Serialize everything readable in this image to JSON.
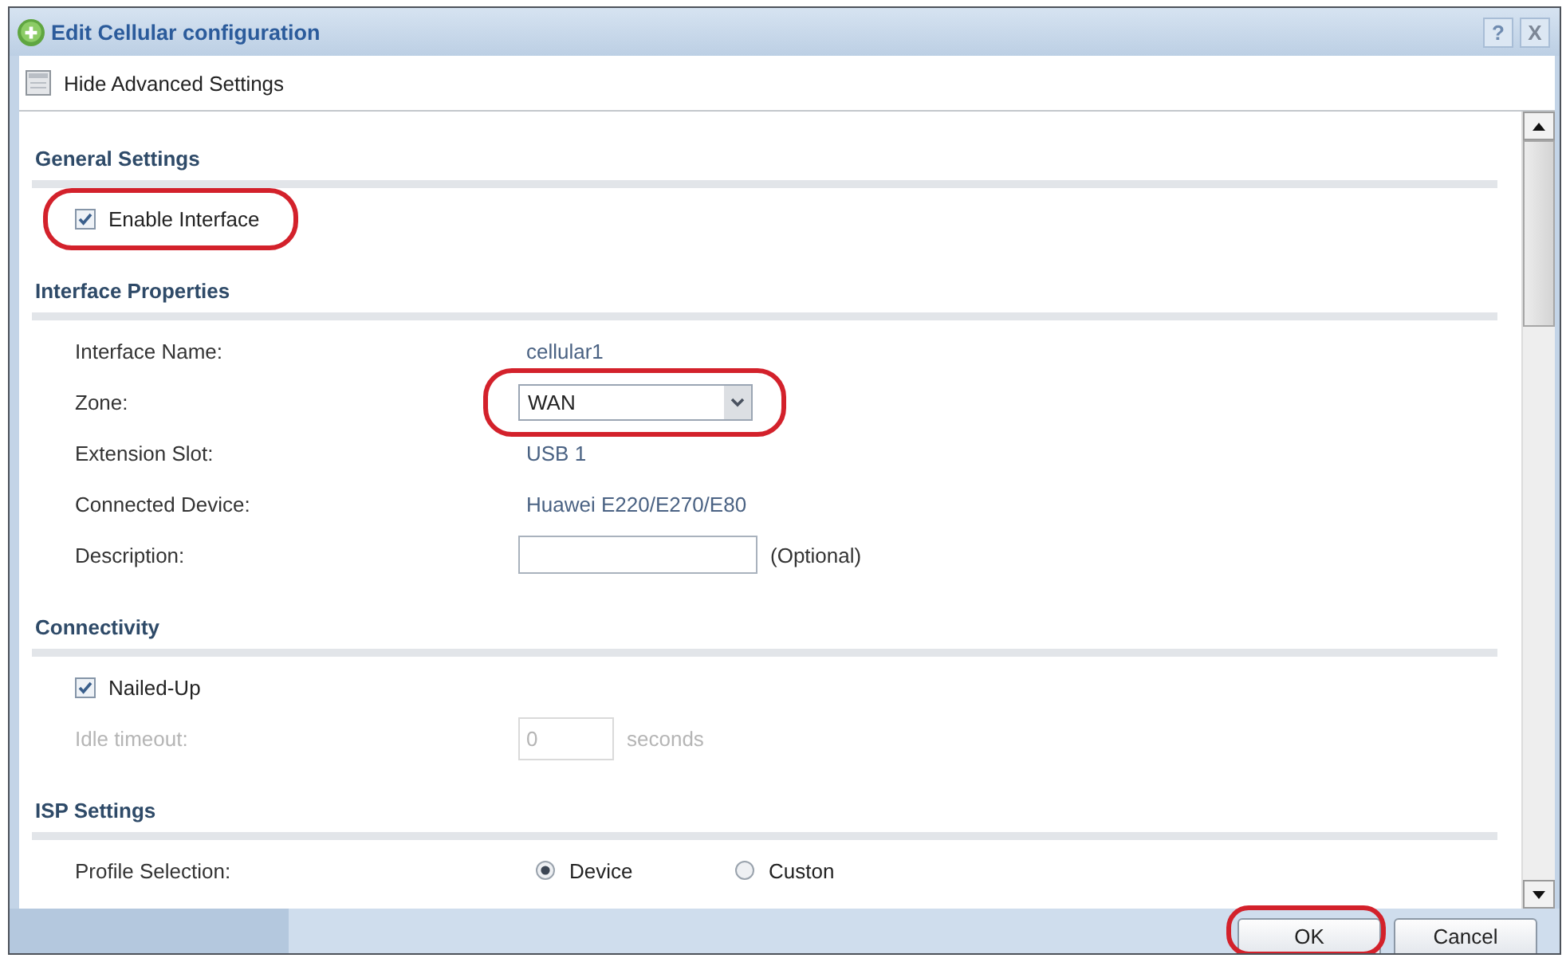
{
  "window": {
    "title": "Edit Cellular configuration",
    "buttons": [
      {
        "kind": "help",
        "label": "?"
      },
      {
        "kind": "close",
        "label": "X"
      }
    ]
  },
  "toolbar": {
    "label": "Hide Advanced Settings"
  },
  "sections": [
    {
      "title": "General Settings",
      "rows": [
        {
          "kind": "checkbox",
          "label": "Enable Interface",
          "checked": true,
          "disabled": false,
          "highlighted": true
        }
      ]
    },
    {
      "title": "Interface Properties",
      "rows": [
        {
          "kind": "text",
          "label": "Interface Name:",
          "value": "cellular1",
          "disabled": false,
          "highlighted": false
        },
        {
          "kind": "select",
          "label": "Zone:",
          "value": "WAN",
          "disabled": false,
          "highlighted": true
        },
        {
          "kind": "text",
          "label": "Extension Slot:",
          "value": "USB 1",
          "disabled": false,
          "highlighted": false
        },
        {
          "kind": "text",
          "label": "Connected Device:",
          "value": "Huawei E220/E270/E80",
          "disabled": false,
          "highlighted": false
        },
        {
          "kind": "input",
          "label": "Description:",
          "note": "(Optional)",
          "disabled": false,
          "highlighted": false
        }
      ]
    },
    {
      "title": "Connectivity",
      "rows": [
        {
          "kind": "checkbox",
          "label": "Nailed-Up",
          "checked": true,
          "disabled": false,
          "highlighted": false
        },
        {
          "kind": "number",
          "label": "Idle timeout:",
          "value": "0",
          "note": "seconds",
          "disabled": true,
          "highlighted": false
        }
      ]
    },
    {
      "title": "ISP Settings",
      "rows": [
        {
          "kind": "radio",
          "label": "Profile Selection:",
          "options": [
            {
              "label": "Device",
              "selected": true
            },
            {
              "label": "Custon",
              "selected": false
            }
          ],
          "disabled": false,
          "highlighted": false
        }
      ]
    }
  ],
  "footer": {
    "buttons": [
      {
        "label": "OK",
        "highlighted": true
      },
      {
        "label": "Cancel",
        "highlighted": false
      }
    ]
  }
}
